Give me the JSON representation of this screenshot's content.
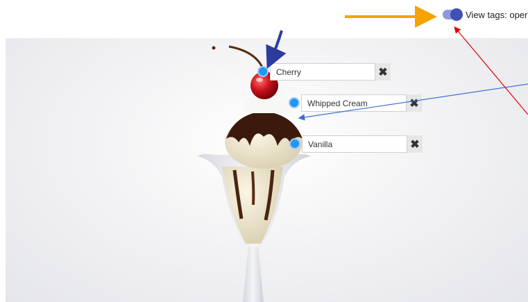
{
  "toolbar": {
    "toggle_label": "View tags: oper",
    "toggle_state": "on",
    "toggle_color": "#3f51b5"
  },
  "tags": [
    {
      "label": "Cherry"
    },
    {
      "label": "Whipped Cream"
    },
    {
      "label": "Vanilla"
    }
  ],
  "icons": {
    "close": "✖"
  },
  "annotation_colors": {
    "orange": "#f5a300",
    "navy": "#2c3c9c",
    "blue": "#3a6fd8",
    "red": "#e00000"
  }
}
